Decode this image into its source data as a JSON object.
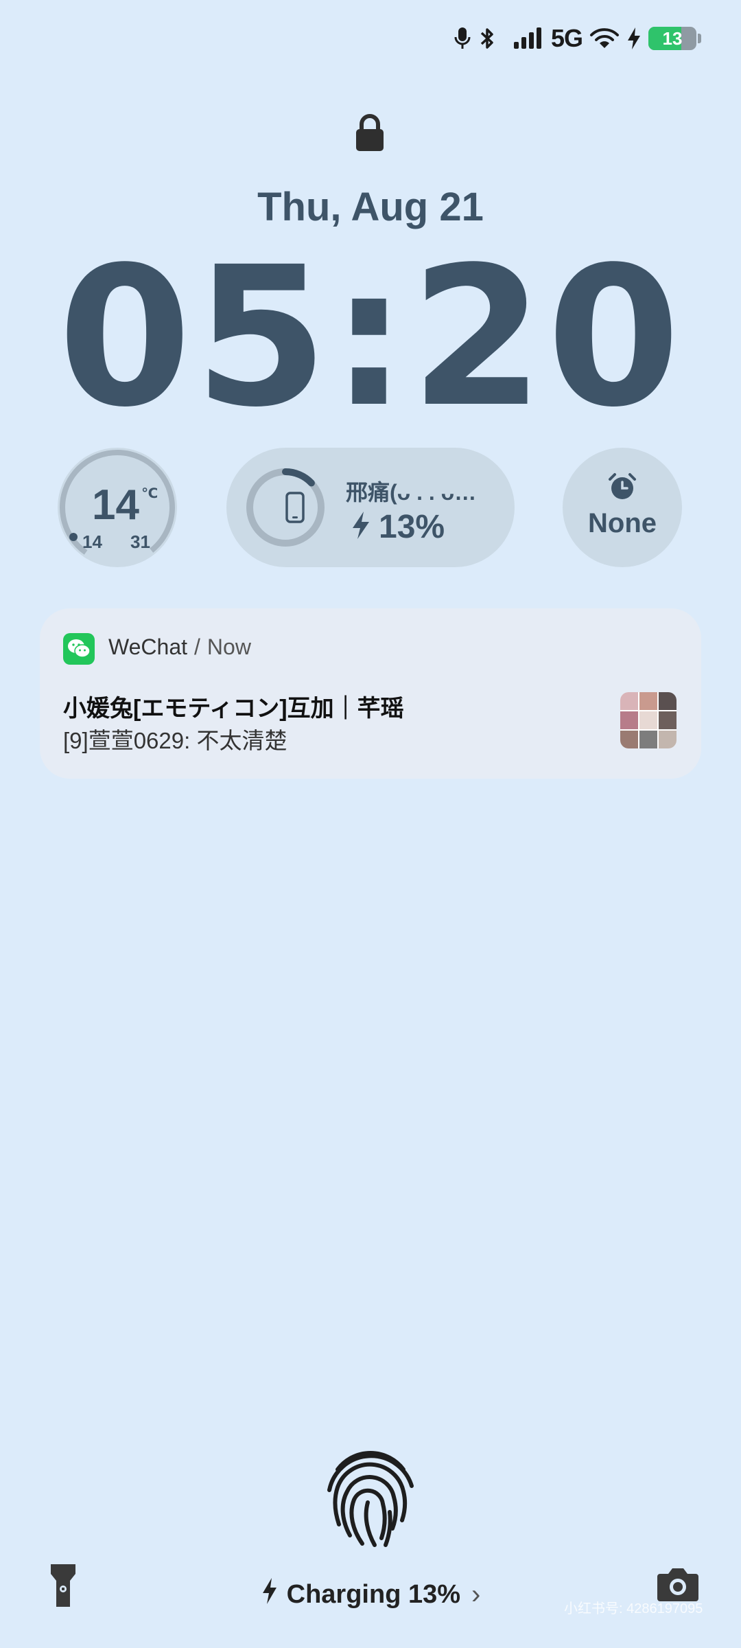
{
  "status_bar": {
    "network": "5G",
    "battery_level": "13",
    "battery_fraction": 0.13,
    "icons": [
      "mic-icon",
      "bluetooth-icon",
      "signal-icon",
      "wifi-icon",
      "charging-bolt-icon"
    ]
  },
  "lock": {
    "icon": "lock-icon"
  },
  "date": "Thu, Aug 21",
  "time": "05:20",
  "weather": {
    "current": "14",
    "unit": "℃",
    "low": "14",
    "high": "31"
  },
  "device_widget": {
    "name": "邢痛(ᴗ . . ᴗ…",
    "charge": "13%",
    "charge_fraction": 0.13
  },
  "alarm": {
    "label": "None"
  },
  "notification": {
    "app": "WeChat",
    "separator": "/",
    "time": "Now",
    "title": "小媛兔[エモティコン]互加｜芊瑶",
    "body": "[9]萱萱0629: 不太清楚"
  },
  "bottom": {
    "charging": "Charging 13%",
    "watermark": "小红书号: 4286197095"
  },
  "colors": {
    "background": "#dcebfa",
    "text": "#3e5468",
    "widget_bg": "#cbdae6",
    "wechat_green": "#22c65a",
    "battery_green": "#2fc36b"
  }
}
